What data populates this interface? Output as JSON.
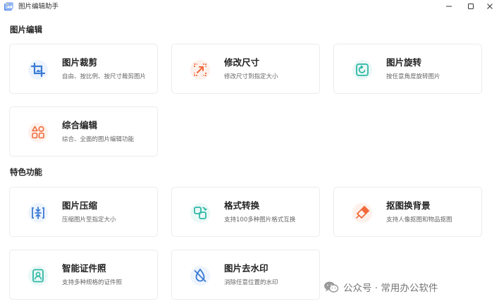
{
  "window": {
    "title": "图片编辑助手"
  },
  "sections": {
    "edit": "图片编辑",
    "special": "特色功能"
  },
  "cards": {
    "crop": {
      "title": "图片裁剪",
      "desc": "自由、按比例、按尺寸裁剪图片"
    },
    "resize": {
      "title": "修改尺寸",
      "desc": "修改尺寸到指定大小"
    },
    "rotate": {
      "title": "图片旋转",
      "desc": "按任意角度旋转图片"
    },
    "composite": {
      "title": "综合编辑",
      "desc": "综合、全面的图片编辑功能"
    },
    "compress": {
      "title": "图片压缩",
      "desc": "压缩图片至指定大小"
    },
    "format": {
      "title": "格式转换",
      "desc": "支持100多种图片格式互换"
    },
    "cutout": {
      "title": "抠图换背景",
      "desc": "支持人像抠图和物品抠图"
    },
    "idphoto": {
      "title": "智能证件照",
      "desc": "支持多种规格的证件照"
    },
    "watermark": {
      "title": "图片去水印",
      "desc": "消除任意位置的水印"
    }
  },
  "overlay": {
    "watermark_text": "公众号 · 常用办公软件"
  },
  "colors": {
    "blue": "#3a7bd5",
    "orange": "#f06a3a",
    "teal": "#2eb8a6"
  }
}
